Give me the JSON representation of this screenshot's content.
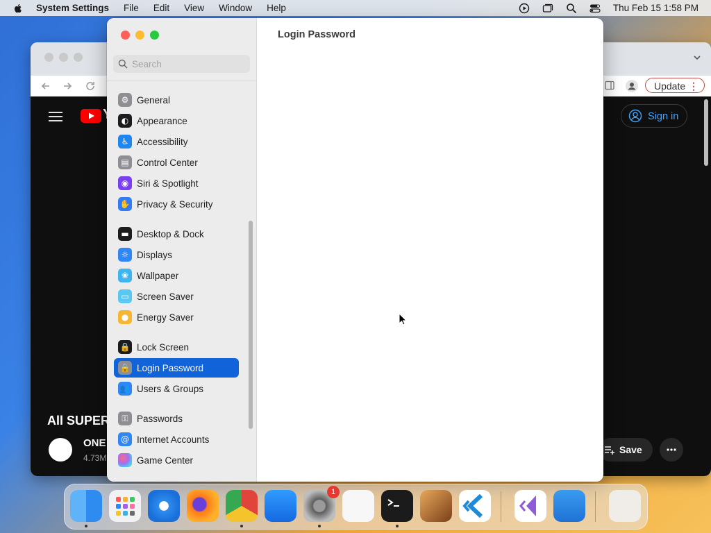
{
  "menubar": {
    "app_name": "System Settings",
    "menus": [
      "File",
      "Edit",
      "View",
      "Window",
      "Help"
    ],
    "clock": "Thu Feb 15  1:58 PM"
  },
  "browser": {
    "update_label": "Update",
    "signin_label": "Sign in",
    "video_title": "All SUPER",
    "channel_name": "ONE",
    "channel_subs": "4.73M",
    "save_label": "Save"
  },
  "settings": {
    "search_placeholder": "Search",
    "page_title": "Login Password",
    "sidebar": [
      {
        "label": "General",
        "icon": "gear-icon",
        "color": "#8e8e93"
      },
      {
        "label": "Appearance",
        "icon": "appearance-icon",
        "color": "#1c1c1e"
      },
      {
        "label": "Accessibility",
        "icon": "accessibility-icon",
        "color": "#1f86f0"
      },
      {
        "label": "Control Center",
        "icon": "control-center-icon",
        "color": "#8e8e93"
      },
      {
        "label": "Siri & Spotlight",
        "icon": "siri-icon",
        "color": "#7b3ff2"
      },
      {
        "label": "Privacy & Security",
        "icon": "hand-icon",
        "color": "#2f7cf6"
      },
      {
        "label": "Desktop & Dock",
        "icon": "dock-icon",
        "color": "#1c1c1e"
      },
      {
        "label": "Displays",
        "icon": "displays-icon",
        "color": "#2f86f5"
      },
      {
        "label": "Wallpaper",
        "icon": "wallpaper-icon",
        "color": "#3fb5f0"
      },
      {
        "label": "Screen Saver",
        "icon": "screen-saver-icon",
        "color": "#5ac8f0"
      },
      {
        "label": "Energy Saver",
        "icon": "energy-icon",
        "color": "#f5b731"
      },
      {
        "label": "Lock Screen",
        "icon": "lock-icon",
        "color": "#1c1c1e"
      },
      {
        "label": "Login Password",
        "icon": "lock-icon",
        "color": "#8e8e93",
        "selected": true
      },
      {
        "label": "Users & Groups",
        "icon": "users-icon",
        "color": "#2f86f5"
      },
      {
        "label": "Passwords",
        "icon": "key-icon",
        "color": "#8e8e93"
      },
      {
        "label": "Internet Accounts",
        "icon": "at-icon",
        "color": "#2f86f5"
      },
      {
        "label": "Game Center",
        "icon": "game-center-icon",
        "color": "#e8e8e8"
      }
    ]
  },
  "dock": {
    "apps": [
      "finder-icon",
      "launchpad-icon",
      "safari-icon",
      "firefox-icon",
      "chrome-icon",
      "app-store-icon",
      "system-settings-icon",
      "textedit-icon",
      "terminal-icon",
      "garageband-icon",
      "vscode-icon",
      "visual-studio-icon",
      "weather-icon",
      "trash-icon"
    ],
    "settings_badge": "1"
  }
}
